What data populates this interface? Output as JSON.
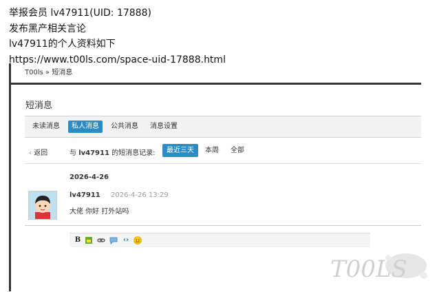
{
  "report": {
    "line1": "举报会员 lv47911(UID: 17888)",
    "line2": "发布黑产相关言论",
    "line3": "lv47911的个人资料如下",
    "line4": "https://www.t00ls.com/space-uid-17888.html"
  },
  "breadcrumb": {
    "site": "T00ls",
    "sep": "»",
    "page": "短消息"
  },
  "page_title": "短消息",
  "tabs": [
    {
      "label": "未读消息",
      "active": false
    },
    {
      "label": "私人消息",
      "active": true
    },
    {
      "label": "公共消息",
      "active": false
    },
    {
      "label": "消息设置",
      "active": false
    }
  ],
  "filter": {
    "back_label": "返回",
    "prefix": "与",
    "user": "lv47911",
    "suffix": "的短消息记录:",
    "options": [
      {
        "label": "最近三天",
        "active": true
      },
      {
        "label": "本周",
        "active": false
      },
      {
        "label": "全部",
        "active": false
      }
    ]
  },
  "message": {
    "date_header": "2026-4-26",
    "user": "lv47911",
    "time": "2026-4-26 13:29",
    "body": "大佬 你好 打外站吗"
  },
  "editor_icons": [
    "bold-icon",
    "image-icon",
    "link-icon",
    "quote-icon",
    "code-icon",
    "smiley-icon"
  ],
  "colors": {
    "accent": "#2b8cc4",
    "frame": "#333333"
  },
  "watermark": {
    "text": "T00LS"
  }
}
